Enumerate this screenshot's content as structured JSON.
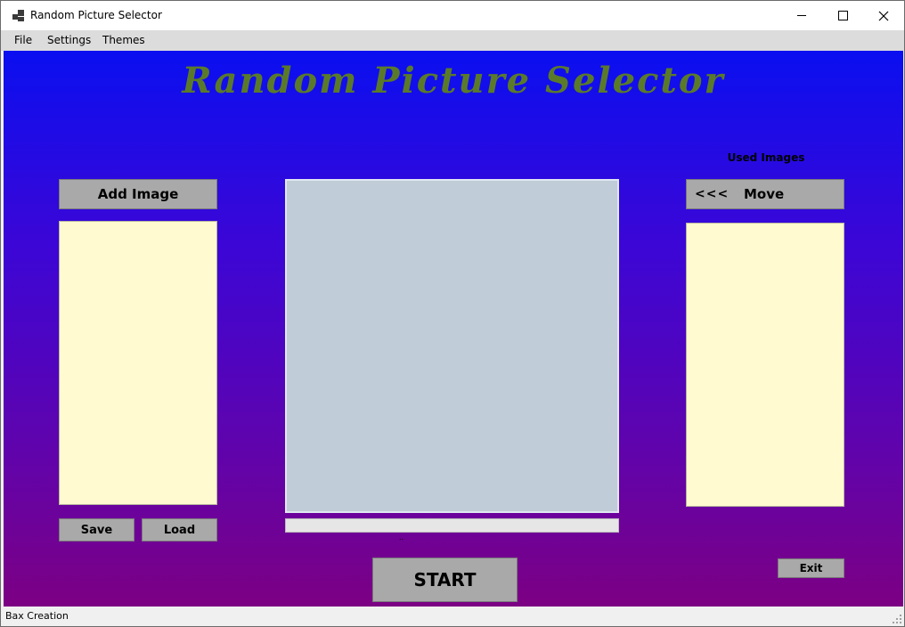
{
  "window": {
    "title": "Random Picture Selector"
  },
  "menu": {
    "items": [
      {
        "label": "File"
      },
      {
        "label": "Settings"
      },
      {
        "label": "Themes"
      }
    ]
  },
  "main": {
    "heading": "Random Picture Selector",
    "add_image_label": "Add Image",
    "save_label": "Save",
    "load_label": "Load",
    "used_images_label": "Used Images",
    "move_arrows": "<<<",
    "move_label": "Move",
    "start_label": "START",
    "exit_label": "Exit",
    "small_caption": "..",
    "progress_value": 0
  },
  "status": {
    "text": "Bax Creation"
  },
  "colors": {
    "gradient_top": "#0a0ff0",
    "gradient_bottom": "#7c0083",
    "title_color": "#5a7a2a",
    "list_bg": "#fffad0",
    "picture_bg": "#c0ccd8",
    "button_bg": "#a9a9a9"
  }
}
